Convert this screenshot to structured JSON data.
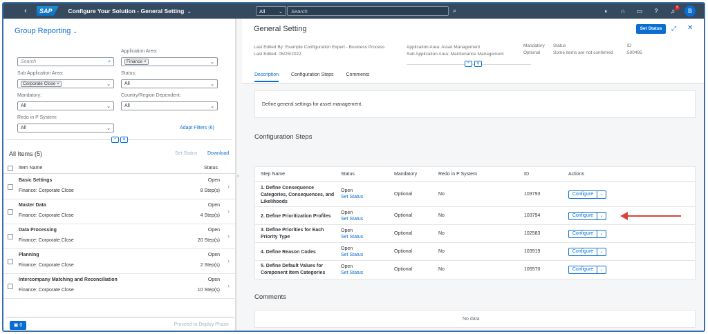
{
  "shell": {
    "back_icon": "‹",
    "logo": "SAP",
    "title": "Configure Your Solution - General Setting",
    "search_scope": "All",
    "search_placeholder": "Search",
    "notification_count": "5",
    "avatar": "B"
  },
  "left": {
    "group_title": "Group Reporting",
    "search_placeholder": "Search",
    "filters": {
      "app_area_label": "Application Area:",
      "app_area_token": "Finance",
      "sub_app_area_label": "Sub Application Area:",
      "sub_app_area_token": "Corporate Close",
      "status_label": "Status:",
      "status_value": "All",
      "mandatory_label": "Mandatory:",
      "mandatory_value": "All",
      "country_label": "Country/Region Dependent:",
      "country_value": "All",
      "redo_label": "Redo in P System:",
      "redo_value": "All",
      "adapt_filters": "Adapt Filters (6)"
    },
    "all_items": "All Items (5)",
    "set_status": "Set Status",
    "download": "Download",
    "col_item_name": "Item Name",
    "col_status": "Status",
    "items": [
      {
        "name": "Basic Settings",
        "sub": "Finance: Corporate Close",
        "status": "Open",
        "steps": "8 Step(s)"
      },
      {
        "name": "Master Data",
        "sub": "Finance: Corporate Close",
        "status": "Open",
        "steps": "4 Step(s)"
      },
      {
        "name": "Data Processing",
        "sub": "Finance: Corporate Close",
        "status": "Open",
        "steps": "20 Step(s)"
      },
      {
        "name": "Planning",
        "sub": "Finance: Corporate Close",
        "status": "Open",
        "steps": "2 Step(s)"
      },
      {
        "name": "Intercompany Matching and Reconciliation",
        "sub": "Finance: Corporate Close",
        "status": "Open",
        "steps": "10 Step(s)"
      }
    ],
    "messages_count": "0",
    "proceed": "Proceed to Deploy Phase"
  },
  "right": {
    "title": "General Setting",
    "set_status_btn": "Set Status",
    "meta": {
      "last_edited_by": "Last Edited By: Example Configuration Expert - Business Process",
      "last_edited": "Last Edited: 05/25/2022",
      "app_area": "Application Area: Asset Management",
      "sub_app_area": "Sub Application Area: Maintenance Management",
      "mandatory_label": "Mandatory",
      "mandatory_value": "Optional",
      "status_label": "Status",
      "status_value": "Some items are not confirmed",
      "id_label": "ID",
      "id_value": "500495"
    },
    "tabs": [
      "Description",
      "Configuration Steps",
      "Comments"
    ],
    "description": "Define general settings for asset management.",
    "config_steps_title": "Configuration Steps",
    "columns": {
      "step_name": "Step Name",
      "status": "Status",
      "mandatory": "Mandatory",
      "redo": "Redo in P System",
      "id": "ID",
      "actions": "Actions"
    },
    "steps": [
      {
        "name": "1. Define Consequence Categories, Consequences, and Likelihoods",
        "status": "Open",
        "link": "Set Status",
        "mandatory": "Optional",
        "redo": "No",
        "id": "103793",
        "action": "Configure"
      },
      {
        "name": "2. Define Prioritization Profiles",
        "status": "Open",
        "link": "Set Status",
        "mandatory": "Optional",
        "redo": "No",
        "id": "103794",
        "action": "Configure"
      },
      {
        "name": "3. Define Priorities for Each Priority Type",
        "status": "Open",
        "link": "Set Status",
        "mandatory": "Optional",
        "redo": "No",
        "id": "102583",
        "action": "Configure"
      },
      {
        "name": "4. Define Reason Codes",
        "status": "Open",
        "link": "Set Status",
        "mandatory": "Optional",
        "redo": "No",
        "id": "103919",
        "action": "Configure"
      },
      {
        "name": "5. Define Default Values for Component Item Categories",
        "status": "Open",
        "link": "Set Status",
        "mandatory": "Optional",
        "redo": "No",
        "id": "105570",
        "action": "Configure"
      }
    ],
    "comments_title": "Comments",
    "no_data": "No data"
  },
  "colors": {
    "shell": "#354a5f",
    "accent": "#0a6ed1",
    "annotation_arrow": "#d9423a"
  }
}
